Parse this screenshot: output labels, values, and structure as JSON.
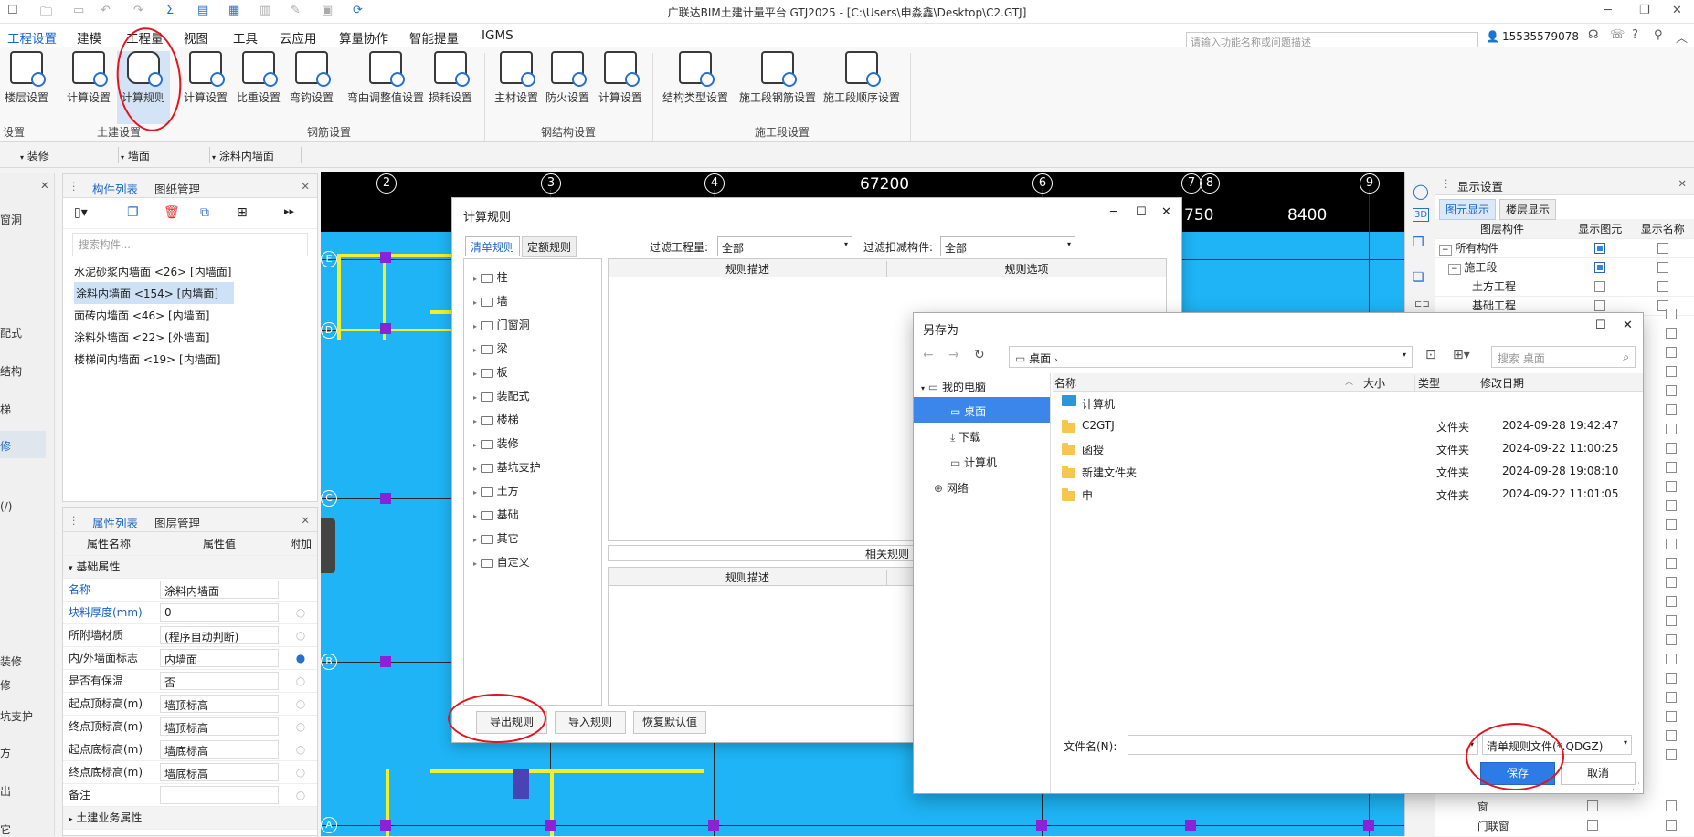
{
  "app": {
    "title": "广联达BIM土建计量平台 GTJ2025 - [C:\\Users\\申淼鑫\\Desktop\\C2.GTJ]"
  },
  "menu": {
    "items": [
      "工程设置",
      "建模",
      "工程量",
      "视图",
      "工具",
      "云应用",
      "算量协作",
      "智能提量",
      "IGMS"
    ],
    "search_placeholder": "请输入功能名称或问题描述",
    "user": "15535579078"
  },
  "ribbon": {
    "buttons": [
      "楼层设置",
      "计算设置",
      "计算规则",
      "计算设置",
      "比重设置",
      "弯钩设置",
      "弯曲调整值设置",
      "损耗设置",
      "主材设置",
      "防火设置",
      "计算设置",
      "结构类型设置",
      "施工段钢筋设置",
      "施工段顺序设置"
    ],
    "groups": [
      "设置",
      "土建设置",
      "钢筋设置",
      "钢结构设置",
      "施工段设置"
    ]
  },
  "filter": {
    "a": "装修",
    "b": "墙面",
    "c": "涂料内墙面"
  },
  "leftnav": [
    "窗洞",
    "配式",
    "结构",
    "梯",
    "修",
    "(/)",
    "装修",
    "修",
    "坑支护",
    "方",
    "出",
    "它"
  ],
  "complist": {
    "tabs": [
      "构件列表",
      "图纸管理"
    ],
    "search_placeholder": "搜索构件...",
    "items": [
      "水泥砂浆内墙面 <26> [内墙面]",
      "涂料内墙面 <154> [内墙面]",
      "面砖内墙面 <46> [内墙面]",
      "涂料外墙面 <22> [外墙面]",
      "楼梯间内墙面 <19> [内墙面]"
    ]
  },
  "props": {
    "tabs": [
      "属性列表",
      "图层管理"
    ],
    "headers": [
      "属性名称",
      "属性值",
      "附加"
    ],
    "section": "基础属性",
    "rows": [
      {
        "name": "名称",
        "value": "涂料内墙面"
      },
      {
        "name": "块料厚度(mm)",
        "value": "0"
      },
      {
        "name": "所附墙材质",
        "value": "(程序自动判断)"
      },
      {
        "name": "内/外墙面标志",
        "value": "内墙面"
      },
      {
        "name": "是否有保温",
        "value": "否"
      },
      {
        "name": "起点顶标高(m)",
        "value": "墙顶标高"
      },
      {
        "name": "终点顶标高(m)",
        "value": "墙顶标高"
      },
      {
        "name": "起点底标高(m)",
        "value": "墙底标高"
      },
      {
        "name": "终点底标高(m)",
        "value": "墙底标高"
      },
      {
        "name": "备注",
        "value": ""
      }
    ],
    "section2": "土建业务属性"
  },
  "canvas": {
    "dim_top": "67200",
    "dim_a": "750",
    "dim_b": "8400",
    "axes_top": [
      "2",
      "3",
      "4",
      "6",
      "7",
      "8",
      "9"
    ],
    "axes_left": [
      "E",
      "D",
      "C",
      "B",
      "A"
    ]
  },
  "display": {
    "title": "显示设置",
    "tabs": [
      "图元显示",
      "楼层显示"
    ],
    "headers": [
      "图层构件",
      "显示图元",
      "显示名称"
    ],
    "rows": [
      {
        "label": "所有构件",
        "indent": 0
      },
      {
        "label": "施工段",
        "indent": 1
      },
      {
        "label": "土方工程",
        "indent": 2
      },
      {
        "label": "基础工程",
        "indent": 2
      }
    ],
    "bottom_rows": [
      "窗",
      "门联窗"
    ]
  },
  "rule_dialog": {
    "title": "计算规则",
    "tabs": [
      "清单规则",
      "定额规则"
    ],
    "filter_qty_label": "过滤工程量:",
    "filter_qty_value": "全部",
    "filter_deduct_label": "过滤扣减构件:",
    "filter_deduct_value": "全部",
    "tree": [
      "柱",
      "墙",
      "门窗洞",
      "梁",
      "板",
      "装配式",
      "楼梯",
      "装修",
      "基坑支护",
      "土方",
      "基础",
      "其它",
      "自定义"
    ],
    "col_desc": "规则描述",
    "col_opt": "规则选项",
    "related": "相关规则",
    "buttons": {
      "export": "导出规则",
      "import": "导入规则",
      "restore": "恢复默认值"
    }
  },
  "save_dialog": {
    "title": "另存为",
    "path": "桌面",
    "search_placeholder": "搜索 桌面",
    "nav": [
      "我的电脑",
      "桌面",
      "下载",
      "计算机",
      "网络"
    ],
    "cols": [
      "名称",
      "大小",
      "类型",
      "修改日期"
    ],
    "files": [
      {
        "name": "计算机",
        "type": "",
        "date": "",
        "kind": "pc"
      },
      {
        "name": "C2GTJ",
        "type": "文件夹",
        "date": "2024-09-28 19:42:47",
        "kind": "folder"
      },
      {
        "name": "函授",
        "type": "文件夹",
        "date": "2024-09-22 11:00:25",
        "kind": "folder"
      },
      {
        "name": "新建文件夹",
        "type": "文件夹",
        "date": "2024-09-28 19:08:10",
        "kind": "folder"
      },
      {
        "name": "申",
        "type": "文件夹",
        "date": "2024-09-22 11:01:05",
        "kind": "folder"
      }
    ],
    "filename_label": "文件名(N):",
    "filetype": "清单规则文件(*.QDGZ)",
    "save": "保存",
    "cancel": "取消"
  },
  "colors": {
    "accent": "#1a66c9",
    "canvas": "#1eb4f5",
    "highlight": "#e2141c"
  }
}
